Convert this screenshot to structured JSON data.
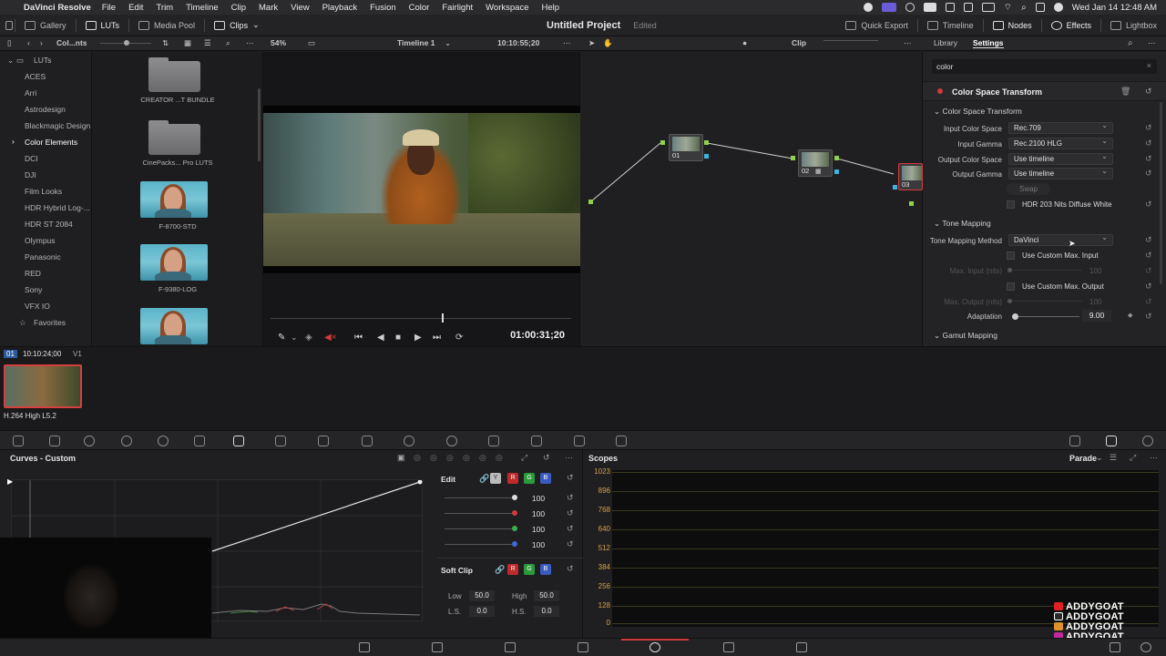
{
  "menubar": {
    "app_name": "DaVinci Resolve",
    "items": [
      "File",
      "Edit",
      "Trim",
      "Timeline",
      "Clip",
      "Mark",
      "View",
      "Playback",
      "Fusion",
      "Color",
      "Fairlight",
      "Workspace",
      "Help"
    ],
    "clock": "Wed Jan 14  12:48 AM"
  },
  "topbar": {
    "gallery": "Gallery",
    "luts": "LUTs",
    "media_pool": "Media Pool",
    "clips": "Clips",
    "project_title": "Untitled Project",
    "edited": "Edited",
    "quick_export": "Quick Export",
    "timeline": "Timeline",
    "nodes": "Nodes",
    "effects": "Effects",
    "lightbox": "Lightbox"
  },
  "toolbar2": {
    "folder_label": "Col...nts",
    "zoom": "54%",
    "timeline_name": "Timeline 1",
    "timecode": "10:10:55;20",
    "clip_mode": "Clip",
    "library_tab": "Library",
    "settings_tab": "Settings"
  },
  "lut_sidebar": {
    "root": "LUTs",
    "items": [
      "ACES",
      "Arri",
      "Astrodesign",
      "Blackmagic Design",
      "Color Elements",
      "DCI",
      "DJI",
      "Film Looks",
      "HDR Hybrid Log-...",
      "HDR ST 2084",
      "Olympus",
      "Panasonic",
      "RED",
      "Sony",
      "VFX IO",
      "Favorites"
    ],
    "selected": "Color Elements"
  },
  "lut_browser": {
    "items": [
      "CREATOR ...T BUNDLE",
      "CinePacks... Pro LUTS",
      "F-8700-STD",
      "F-9380-LOG"
    ]
  },
  "viewer": {
    "timecode": "01:00:31;20"
  },
  "nodes": {
    "list": [
      "01",
      "02",
      "03"
    ]
  },
  "inspector": {
    "search_value": "color",
    "effect_title": "Color Space Transform",
    "section_cst": "Color Space Transform",
    "input_color_space_label": "Input Color Space",
    "input_color_space": "Rec.709",
    "input_gamma_label": "Input Gamma",
    "input_gamma": "Rec.2100 HLG",
    "output_color_space_label": "Output Color Space",
    "output_color_space": "Use timeline",
    "output_gamma_label": "Output Gamma",
    "output_gamma": "Use timeline",
    "swap": "Swap",
    "hdr_203": "HDR 203 Nits Diffuse White",
    "section_tone": "Tone Mapping",
    "tone_method_label": "Tone Mapping Method",
    "tone_method": "DaVinci",
    "custom_max_input": "Use Custom Max. Input",
    "max_input_label": "Max. Input (nits)",
    "max_input_value": "100",
    "custom_max_output": "Use Custom Max. Output",
    "max_output_label": "Max. Output (nits)",
    "max_output_value": "100",
    "adaptation_label": "Adaptation",
    "adaptation_value": "9.00",
    "section_gamut": "Gamut Mapping"
  },
  "clipstrip": {
    "clip_number": "01",
    "clip_tc": "10:10:24;00",
    "track": "V1",
    "codec": "H.264 High L5.2"
  },
  "curves": {
    "title": "Curves - Custom",
    "edit_label": "Edit",
    "channels": [
      "Y",
      "R",
      "G",
      "B"
    ],
    "values": [
      "100",
      "100",
      "100",
      "100"
    ],
    "soft_clip_label": "Soft Clip",
    "low_label": "Low",
    "low_value": "50.0",
    "high_label": "High",
    "high_value": "50.0",
    "ls_label": "L.S.",
    "ls_value": "0.0",
    "hs_label": "H.S.",
    "hs_value": "0.0"
  },
  "scopes": {
    "title": "Scopes",
    "mode": "Parade",
    "scale": [
      "1023",
      "896",
      "768",
      "640",
      "512",
      "384",
      "256",
      "128",
      "0"
    ]
  },
  "watermark": {
    "text": "ADDYGOAT",
    "badge_colors": [
      "#e02020",
      "#2a2a2a",
      "#e0902a",
      "#c02aa0"
    ]
  },
  "colors": {
    "accent_red": "#d23a3a",
    "scope_label": "#d4a246"
  }
}
